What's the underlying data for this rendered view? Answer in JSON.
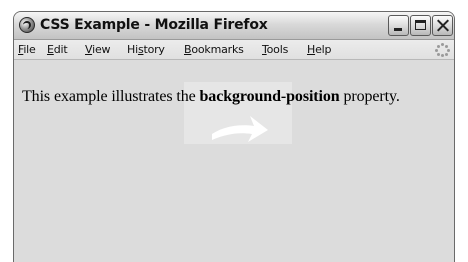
{
  "window": {
    "title": "CSS Example - Mozilla Firefox"
  },
  "menubar": {
    "items": [
      {
        "label": "File",
        "accesskey": "F",
        "rest": "ile"
      },
      {
        "label": "Edit",
        "accesskey": "E",
        "rest": "dit"
      },
      {
        "label": "View",
        "accesskey": "V",
        "rest": "iew"
      },
      {
        "label": "History",
        "accesskey": "s",
        "pre": "Hi",
        "rest": "tory"
      },
      {
        "label": "Bookmarks",
        "accesskey": "B",
        "rest": "ookmarks"
      },
      {
        "label": "Tools",
        "accesskey": "T",
        "rest": "ools"
      },
      {
        "label": "Help",
        "accesskey": "H",
        "rest": "elp"
      }
    ]
  },
  "content": {
    "text_before": "This example illustrates the ",
    "text_bold": "background-position",
    "text_after": " property."
  },
  "icons": {
    "app": "firefox-icon",
    "minimize": "minimize-icon",
    "maximize": "maximize-icon",
    "close": "close-icon",
    "throbber": "throbber-icon",
    "background": "arrow-image"
  },
  "colors": {
    "content_bg": "#dcdcdc",
    "chrome_bg": "#d4d0c8",
    "text": "#000000"
  }
}
